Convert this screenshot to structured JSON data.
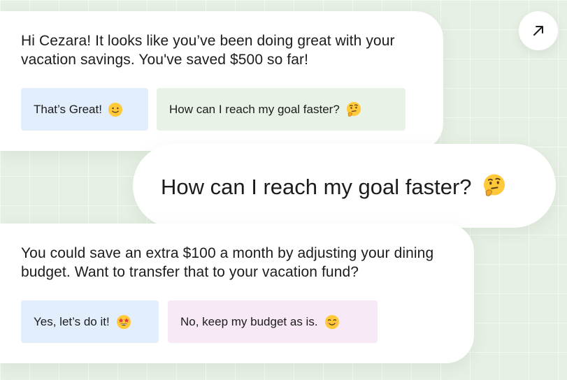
{
  "conversation": {
    "bot_message_1": {
      "text": "Hi Cezara! It looks like you’ve been doing great with your vacation savings. You've saved $500 so far!",
      "replies": [
        {
          "label": "That’s Great!",
          "emoji": "slightly-smiling-face"
        },
        {
          "label": "How can I reach my goal faster?",
          "emoji": "thinking-face"
        }
      ]
    },
    "user_message": {
      "text": "How can I reach my goal faster?",
      "emoji": "thinking-face"
    },
    "bot_message_2": {
      "text": "You could save an extra $100 a month by adjusting your dining budget. Want to transfer that to your vacation fund?",
      "replies": [
        {
          "label": "Yes, let’s do it!",
          "emoji": "star-struck-face"
        },
        {
          "label": "No, keep my budget as is.",
          "emoji": "smiling-face"
        }
      ]
    }
  },
  "controls": {
    "expand_icon": "arrow-up-right-icon"
  },
  "colors": {
    "background": "#e6f0e4",
    "bubble": "#ffffff",
    "chip_blue": "#e2eefc",
    "chip_green": "#e8f2e7",
    "chip_pink": "#f7e9f6",
    "emoji_yellow": "#ffc93a"
  }
}
